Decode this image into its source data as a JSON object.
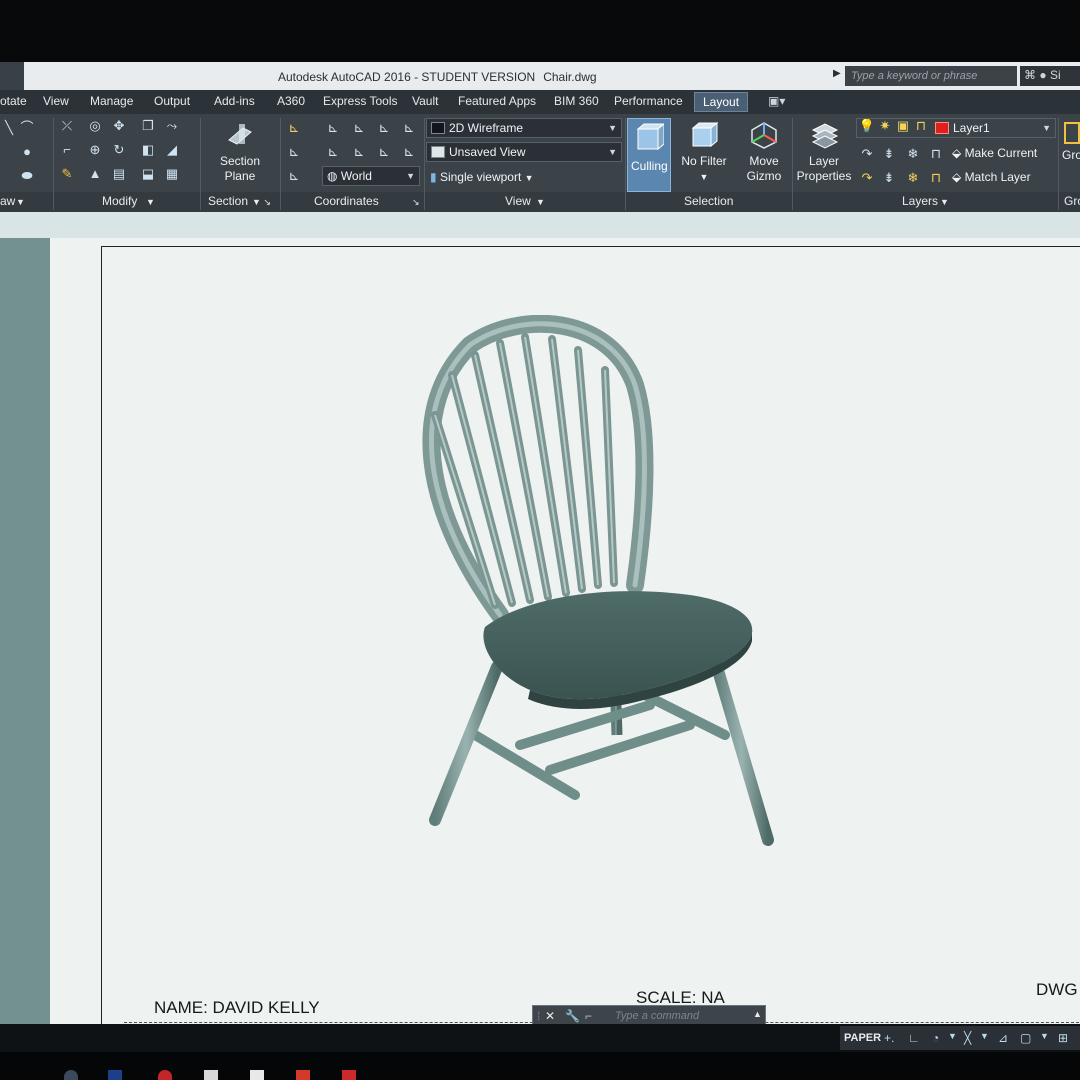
{
  "titlebar": {
    "app_title": "Autodesk AutoCAD 2016 - STUDENT VERSION",
    "file_name": "Chair.dwg",
    "search_placeholder": "Type a keyword or phrase"
  },
  "ribbon_tabs": [
    "otate",
    "View",
    "Manage",
    "Output",
    "Add-ins",
    "A360",
    "Express Tools",
    "Vault",
    "Featured Apps",
    "BIM 360",
    "Performance",
    "Layout"
  ],
  "ribbon": {
    "panels": {
      "draw": "aw",
      "modify": "Modify",
      "section": "Section",
      "coordinates": "Coordinates",
      "view": "View",
      "selection": "Selection",
      "layers": "Layers",
      "groups": "Gro"
    },
    "section_plane": [
      "Section",
      "Plane"
    ],
    "visual_style": "2D Wireframe",
    "named_view": "Unsaved View",
    "ucs": "World",
    "viewport": "Single viewport",
    "culling": "Culling",
    "no_filter": "No Filter",
    "move_gizmo": [
      "Move",
      "Gizmo"
    ],
    "layer_properties": [
      "Layer",
      "Properties"
    ],
    "current_layer": "Layer1",
    "make_current": "Make Current",
    "match_layer": "Match Layer",
    "group_label": "Gro"
  },
  "title_block": {
    "name_label": "NAME: DAVID KELLY",
    "scale_label": "SCALE: NA",
    "dwg_label": "DWG"
  },
  "command_line": {
    "placeholder": "Type a command"
  },
  "status_bar": {
    "space": "PAPER"
  },
  "colors": {
    "layer_color": "#e0201c",
    "tab_bg": "#2b3238",
    "ribbon_bg": "#3b4349",
    "active_highlight": "#5b86b0",
    "model_color": "#6f8e8a"
  },
  "icons": [
    "search-icon",
    "user-icon",
    "section-plane-icon",
    "culling-icon",
    "no-filter-icon",
    "move-gizmo-icon",
    "layer-properties-icon",
    "close-icon",
    "wrench-icon"
  ]
}
